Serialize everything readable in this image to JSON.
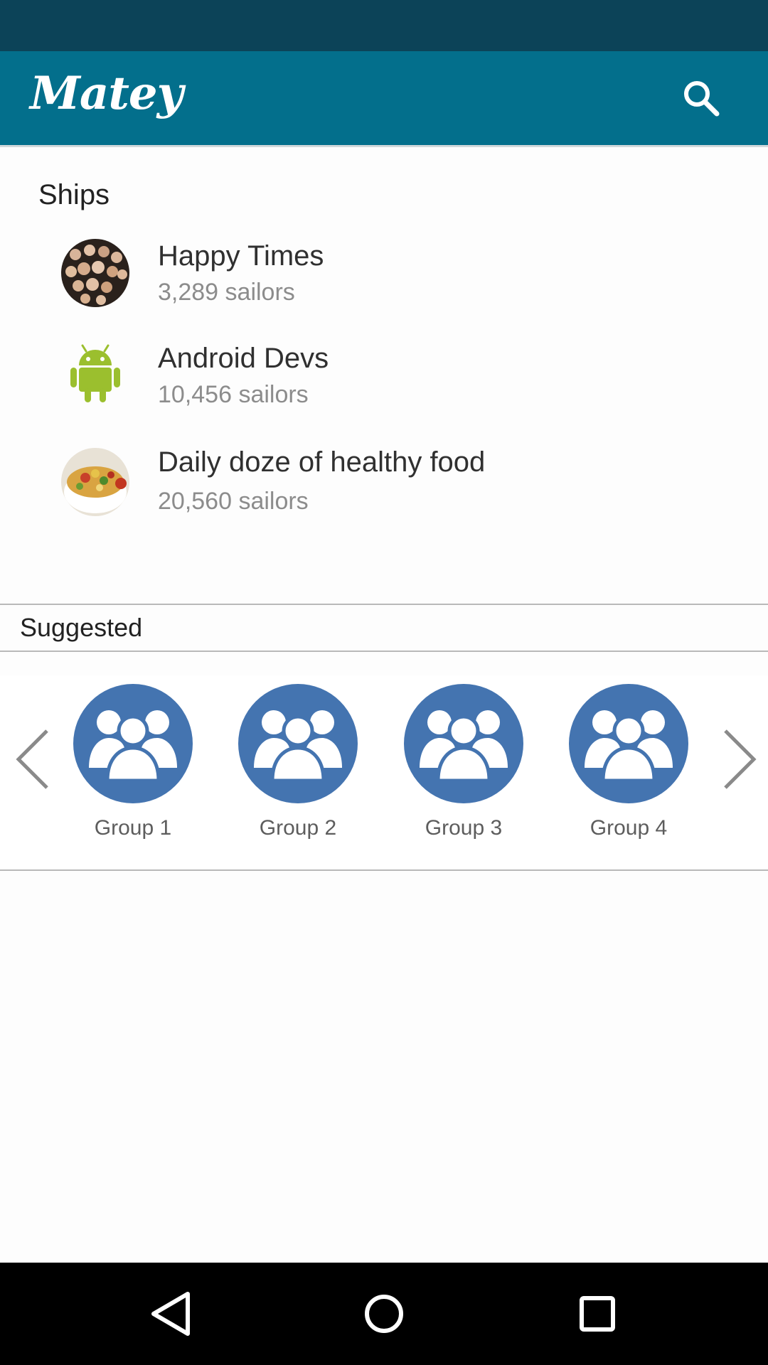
{
  "app_bar": {
    "title": "Matey",
    "search_icon": "search-icon",
    "color": "#036f8c"
  },
  "ships": {
    "heading": "Ships",
    "items": [
      {
        "name": "Happy Times",
        "count": "3,289 sailors",
        "avatar": "crowd-photo"
      },
      {
        "name": "Android Devs",
        "count": "10,456 sailors",
        "avatar": "android-robot-icon"
      },
      {
        "name": "Daily doze of healthy food",
        "count": "20,560 sailors",
        "avatar": "food-bowl-photo"
      }
    ]
  },
  "suggested": {
    "heading": "Suggested",
    "groups": [
      {
        "label": "Group 1",
        "icon": "group-icon"
      },
      {
        "label": "Group 2",
        "icon": "group-icon"
      },
      {
        "label": "Group 3",
        "icon": "group-icon"
      },
      {
        "label": "Group 4",
        "icon": "group-icon"
      }
    ],
    "group_color": "#4474b0"
  },
  "nav": {
    "icons": [
      "back-icon",
      "home-icon",
      "recents-icon"
    ]
  }
}
